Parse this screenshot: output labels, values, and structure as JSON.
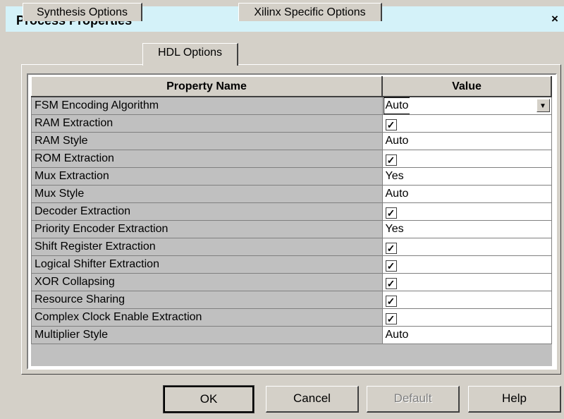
{
  "window": {
    "title": "Process Properties",
    "close_glyph": "×"
  },
  "tabs": [
    {
      "label": "Synthesis Options"
    },
    {
      "label": "HDL Options"
    },
    {
      "label": "Xilinx Specific Options"
    }
  ],
  "grid": {
    "headers": {
      "name": "Property Name",
      "value": "Value"
    },
    "rows": [
      {
        "name": "FSM Encoding Algorithm",
        "value": "Auto"
      },
      {
        "name": "RAM Extraction",
        "checked": true
      },
      {
        "name": "RAM Style",
        "value": "Auto"
      },
      {
        "name": "ROM Extraction",
        "checked": true
      },
      {
        "name": "Mux Extraction",
        "value": "Yes"
      },
      {
        "name": "Mux Style",
        "value": "Auto"
      },
      {
        "name": "Decoder Extraction",
        "checked": true
      },
      {
        "name": "Priority Encoder Extraction",
        "value": "Yes"
      },
      {
        "name": "Shift Register Extraction",
        "checked": true
      },
      {
        "name": "Logical Shifter Extraction",
        "checked": true
      },
      {
        "name": "XOR Collapsing",
        "checked": true
      },
      {
        "name": "Resource Sharing",
        "checked": true
      },
      {
        "name": "Complex Clock Enable Extraction",
        "checked": true
      },
      {
        "name": "Multiplier Style",
        "value": "Auto"
      }
    ],
    "check_glyph": "✓",
    "dropdown_glyph": "▼"
  },
  "buttons": {
    "ok": "OK",
    "cancel": "Cancel",
    "default": "Default",
    "help": "Help"
  }
}
